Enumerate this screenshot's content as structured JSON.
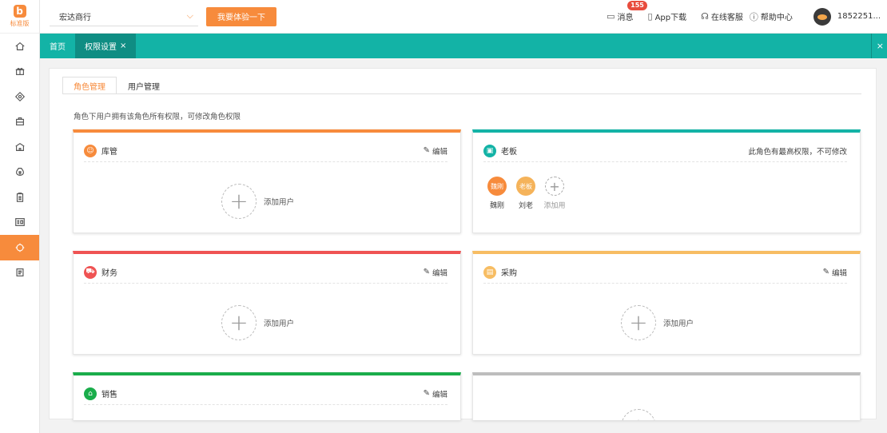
{
  "logo": {
    "mark": "b",
    "text": "标准版"
  },
  "sidebar": {
    "items": [
      {
        "name": "home-icon"
      },
      {
        "name": "gift-icon"
      },
      {
        "name": "tag-icon"
      },
      {
        "name": "bag-icon"
      },
      {
        "name": "store-icon"
      },
      {
        "name": "money-icon"
      },
      {
        "name": "clipboard-icon"
      },
      {
        "name": "id-card-icon"
      },
      {
        "name": "settings-icon",
        "active": true
      },
      {
        "name": "document-icon"
      }
    ]
  },
  "topbar": {
    "store_name": "宏达商行",
    "try_button": "我要体验一下",
    "message_label": "消息",
    "message_count": "155",
    "app_download": "App下载",
    "online_service": "在线客服",
    "help_center": "帮助中心",
    "username": "1852251..."
  },
  "tabs": [
    {
      "label": "首页",
      "active": false
    },
    {
      "label": "权限设置",
      "active": true,
      "closable": true,
      "close": "×"
    }
  ],
  "tabbar_close": "×",
  "subtabs": [
    {
      "label": "角色管理",
      "active": true
    },
    {
      "label": "用户管理",
      "active": false
    }
  ],
  "hint": "角色下用户拥有该角色所有权限，可修改角色权限",
  "roles": [
    {
      "title": "库管",
      "color": "#f78b3c",
      "action": "编辑",
      "add_label": "添加用户",
      "icon": "person-icon"
    },
    {
      "title": "老板",
      "color": "#13b3a6",
      "note": "此角色有最高权限，不可修改",
      "icon": "chat-icon",
      "members": [
        {
          "avatar": "魏刚",
          "name": "魏刚",
          "color": "#f78b3c"
        },
        {
          "avatar": "老板",
          "name": "刘老",
          "color": "#f5b35a"
        }
      ],
      "add_label": "添加用"
    },
    {
      "title": "财务",
      "color": "#ef5353",
      "action": "编辑",
      "add_label": "添加用户",
      "icon": "cart-icon"
    },
    {
      "title": "采购",
      "color": "#f7bd63",
      "action": "编辑",
      "add_label": "添加用户",
      "icon": "chart-icon"
    },
    {
      "title": "销售",
      "color": "#1aad4b",
      "action": "编辑",
      "add_label": "",
      "icon": "shop-icon"
    },
    {
      "title": "",
      "color": "#bdbdbd",
      "add_label": "",
      "icon": ""
    }
  ]
}
